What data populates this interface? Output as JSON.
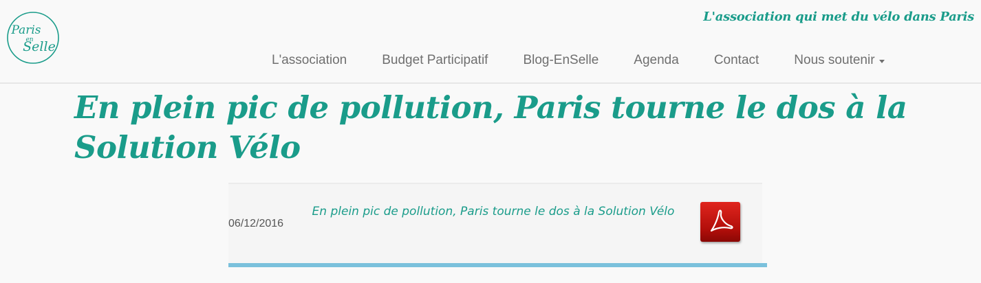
{
  "header": {
    "logo_text_top": "Paris",
    "logo_text_mid": "en",
    "logo_text_bottom": "Selle",
    "tagline": "L'association qui met du vélo dans Paris"
  },
  "nav": {
    "items": [
      {
        "label": "L'association"
      },
      {
        "label": "Budget Participatif"
      },
      {
        "label": "Blog-EnSelle"
      },
      {
        "label": "Agenda"
      },
      {
        "label": "Contact"
      },
      {
        "label": "Nous soutenir"
      }
    ]
  },
  "main": {
    "title": "En plein pic de pollution, Paris tourne le dos à la Solution Vélo",
    "document": {
      "date": "06/12/2016",
      "title": "En plein pic de pollution, Paris tourne le dos à la Solution Vélo",
      "icon": "pdf-icon"
    }
  },
  "colors": {
    "accent": "#1a9c8a",
    "nav_text": "#6f6f6f",
    "card_underline": "#7bc1dc",
    "pdf_red": "#c7140e"
  }
}
